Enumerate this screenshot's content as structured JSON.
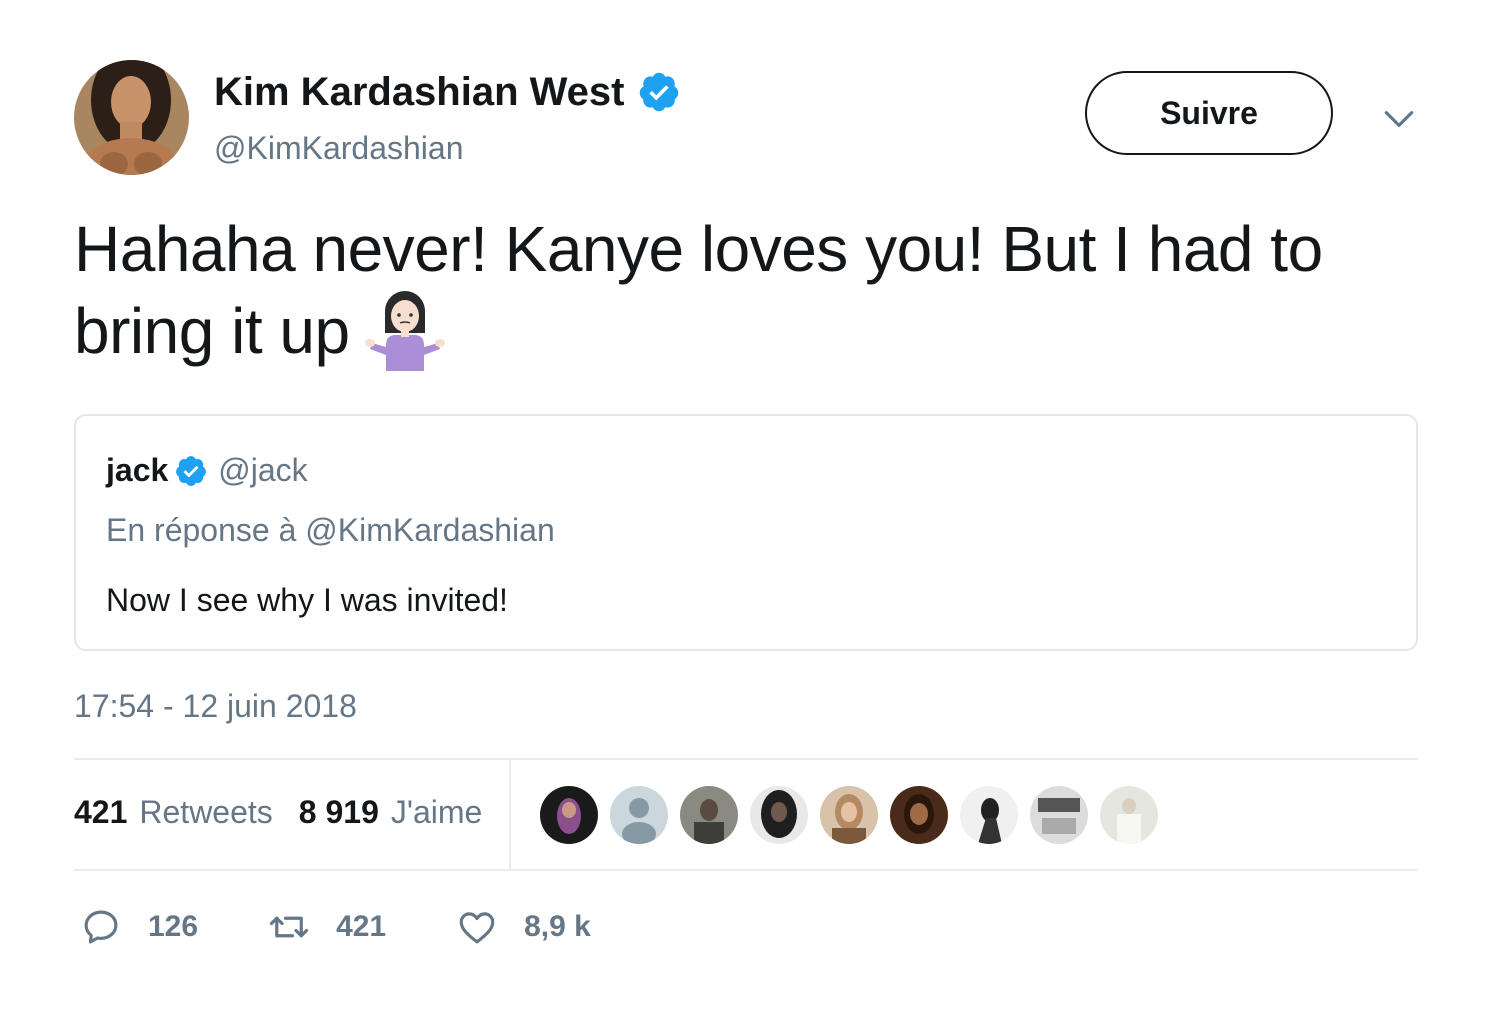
{
  "author": {
    "display_name": "Kim Kardashian West",
    "handle": "@KimKardashian",
    "verified": true
  },
  "follow_button": {
    "label": "Suivre"
  },
  "tweet": {
    "text": "Hahaha never! Kanye loves you! But I had to bring it up",
    "emoji": "woman-shrugging-icon"
  },
  "quoted_tweet": {
    "name": "jack",
    "handle": "@jack",
    "verified": true,
    "reply_context": "En réponse à @KimKardashian",
    "text": "Now I see why I was invited!"
  },
  "timestamp": "17:54 - 12 juin 2018",
  "stats": {
    "retweets_count": "421",
    "retweets_label": "Retweets",
    "likes_count": "8 919",
    "likes_label": "J'aime"
  },
  "actions": {
    "reply_count": "126",
    "retweet_count": "421",
    "like_count": "8,9 k"
  },
  "colors": {
    "verified_blue": "#1da1f2",
    "secondary_text": "#657786",
    "primary_text": "#14171a",
    "border": "#e1e8ed"
  }
}
